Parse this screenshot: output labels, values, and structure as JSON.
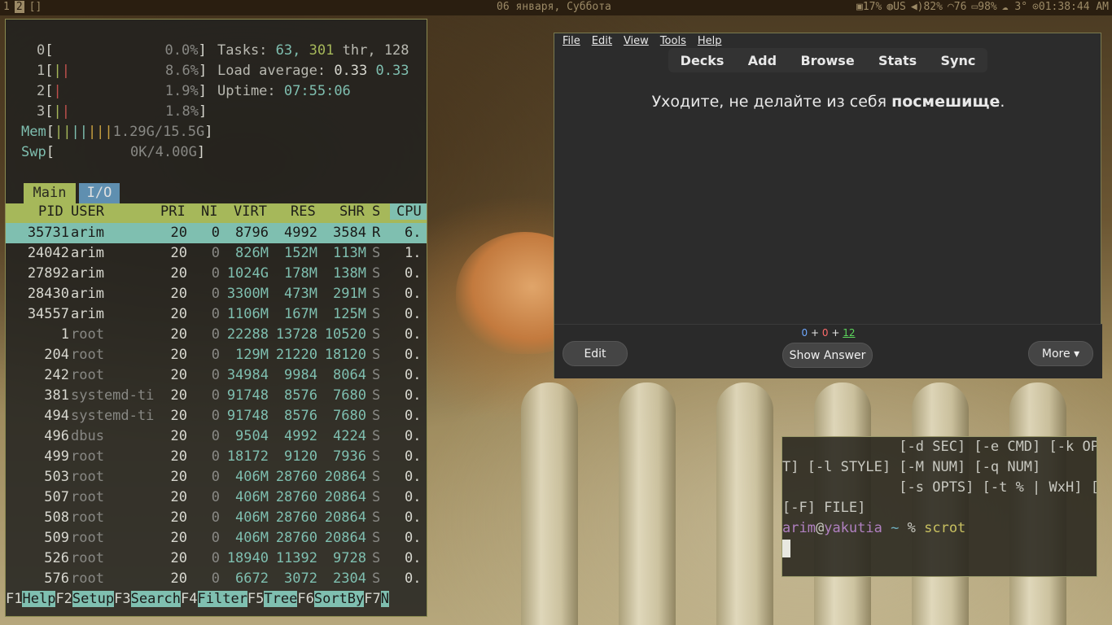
{
  "topbar": {
    "workspaces": [
      "1",
      "2",
      "[]"
    ],
    "date": "06 января, Суббота",
    "cpu": "17%",
    "layout": "US",
    "volume": "82%",
    "wifi": "76",
    "battery": "98%",
    "weather": "3°",
    "time": "01:38:44 AM"
  },
  "htop": {
    "cpus": [
      {
        "id": "0",
        "pct": "0.0%"
      },
      {
        "id": "1",
        "pct": "8.6%"
      },
      {
        "id": "2",
        "pct": "1.9%"
      },
      {
        "id": "3",
        "pct": "1.8%"
      }
    ],
    "mem": {
      "label": "Mem",
      "used": "1.29G",
      "total": "15.5G",
      "value": "1.29G/15.5G"
    },
    "swp": {
      "label": "Swp",
      "value": "0K/4.00G"
    },
    "tasks": {
      "label": "Tasks:",
      "tasks": "63,",
      "threads": "301",
      "thr_label": "thr,",
      "running": "128"
    },
    "load": {
      "label": "Load average:",
      "v1": "0.33",
      "v2": "0.33"
    },
    "uptime": {
      "label": "Uptime:",
      "value": "07:55:06"
    },
    "tabs": [
      "Main",
      "I/O"
    ],
    "columns": [
      "PID",
      "USER",
      "PRI",
      "NI",
      "VIRT",
      "RES",
      "SHR",
      "S",
      "CPU"
    ],
    "processes": [
      {
        "pid": "35731",
        "user": "arim",
        "pri": "20",
        "ni": "0",
        "virt": "8796",
        "res": "4992",
        "shr": "3584",
        "s": "R",
        "cpu": "6."
      },
      {
        "pid": "24042",
        "user": "arim",
        "pri": "20",
        "ni": "0",
        "virt": "826M",
        "res": "152M",
        "shr": "113M",
        "s": "S",
        "cpu": "1."
      },
      {
        "pid": "27892",
        "user": "arim",
        "pri": "20",
        "ni": "0",
        "virt": "1024G",
        "res": "178M",
        "shr": "138M",
        "s": "S",
        "cpu": "0."
      },
      {
        "pid": "28430",
        "user": "arim",
        "pri": "20",
        "ni": "0",
        "virt": "3300M",
        "res": "473M",
        "shr": "291M",
        "s": "S",
        "cpu": "0."
      },
      {
        "pid": "34557",
        "user": "arim",
        "pri": "20",
        "ni": "0",
        "virt": "1106M",
        "res": "167M",
        "shr": "125M",
        "s": "S",
        "cpu": "0."
      },
      {
        "pid": "1",
        "user": "root",
        "pri": "20",
        "ni": "0",
        "virt": "22288",
        "res": "13728",
        "shr": "10520",
        "s": "S",
        "cpu": "0."
      },
      {
        "pid": "204",
        "user": "root",
        "pri": "20",
        "ni": "0",
        "virt": "129M",
        "res": "21220",
        "shr": "18120",
        "s": "S",
        "cpu": "0."
      },
      {
        "pid": "242",
        "user": "root",
        "pri": "20",
        "ni": "0",
        "virt": "34984",
        "res": "9984",
        "shr": "8064",
        "s": "S",
        "cpu": "0."
      },
      {
        "pid": "381",
        "user": "systemd-ti",
        "pri": "20",
        "ni": "0",
        "virt": "91748",
        "res": "8576",
        "shr": "7680",
        "s": "S",
        "cpu": "0."
      },
      {
        "pid": "494",
        "user": "systemd-ti",
        "pri": "20",
        "ni": "0",
        "virt": "91748",
        "res": "8576",
        "shr": "7680",
        "s": "S",
        "cpu": "0."
      },
      {
        "pid": "496",
        "user": "dbus",
        "pri": "20",
        "ni": "0",
        "virt": "9504",
        "res": "4992",
        "shr": "4224",
        "s": "S",
        "cpu": "0."
      },
      {
        "pid": "499",
        "user": "root",
        "pri": "20",
        "ni": "0",
        "virt": "18172",
        "res": "9120",
        "shr": "7936",
        "s": "S",
        "cpu": "0."
      },
      {
        "pid": "503",
        "user": "root",
        "pri": "20",
        "ni": "0",
        "virt": "406M",
        "res": "28760",
        "shr": "20864",
        "s": "S",
        "cpu": "0."
      },
      {
        "pid": "507",
        "user": "root",
        "pri": "20",
        "ni": "0",
        "virt": "406M",
        "res": "28760",
        "shr": "20864",
        "s": "S",
        "cpu": "0."
      },
      {
        "pid": "508",
        "user": "root",
        "pri": "20",
        "ni": "0",
        "virt": "406M",
        "res": "28760",
        "shr": "20864",
        "s": "S",
        "cpu": "0."
      },
      {
        "pid": "509",
        "user": "root",
        "pri": "20",
        "ni": "0",
        "virt": "406M",
        "res": "28760",
        "shr": "20864",
        "s": "S",
        "cpu": "0."
      },
      {
        "pid": "526",
        "user": "root",
        "pri": "20",
        "ni": "0",
        "virt": "18940",
        "res": "11392",
        "shr": "9728",
        "s": "S",
        "cpu": "0."
      },
      {
        "pid": "576",
        "user": "root",
        "pri": "20",
        "ni": "0",
        "virt": "6672",
        "res": "3072",
        "shr": "2304",
        "s": "S",
        "cpu": "0."
      }
    ],
    "fkeys": [
      {
        "key": "F1",
        "label": "Help"
      },
      {
        "key": "F2",
        "label": "Setup"
      },
      {
        "key": "F3",
        "label": "Search"
      },
      {
        "key": "F4",
        "label": "Filter"
      },
      {
        "key": "F5",
        "label": "Tree"
      },
      {
        "key": "F6",
        "label": "SortBy"
      },
      {
        "key": "F7",
        "label": "N"
      }
    ]
  },
  "anki": {
    "menu": [
      "File",
      "Edit",
      "View",
      "Tools",
      "Help"
    ],
    "toolbar": [
      "Decks",
      "Add",
      "Browse",
      "Stats",
      "Sync"
    ],
    "card_text": "Уходите, не делайте из себя ",
    "card_bold": "посмешище",
    "card_end": ".",
    "counts": {
      "new": "0",
      "learn": "0",
      "review": "12",
      "plus": "+"
    },
    "edit_button": "Edit",
    "show_answer_button": "Show Answer",
    "more_button": "More ▾"
  },
  "terminal": {
    "lines": [
      "              [-d SEC] [-e CMD] [-k OP",
      "T] [-l STYLE] [-M NUM] [-q NUM]",
      "              [-s OPTS] [-t % | WxH] [",
      "[-F] FILE]"
    ],
    "prompt_user": "arim",
    "prompt_at": "@",
    "prompt_host": "yakutia",
    "prompt_dir": "~",
    "prompt_sym": "%",
    "command": "scrot"
  }
}
